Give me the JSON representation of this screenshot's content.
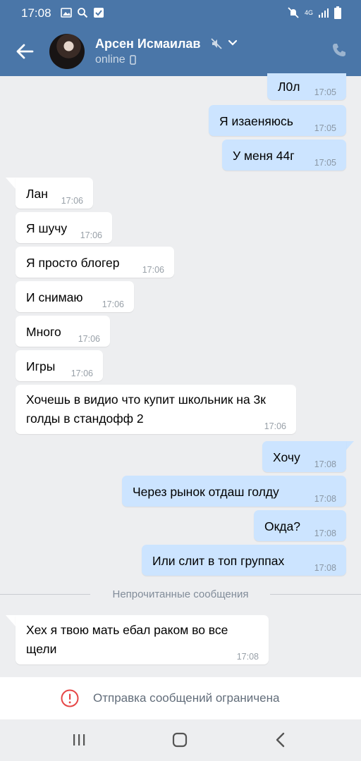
{
  "status_bar": {
    "time": "17:08",
    "network": "4G"
  },
  "header": {
    "contact_name": "Арсен Исмаилав",
    "status": "online"
  },
  "messages": [
    {
      "dir": "out",
      "text": "Л0л",
      "time": "17:05"
    },
    {
      "dir": "out",
      "text": "Я изаеняюсь",
      "time": "17:05"
    },
    {
      "dir": "out",
      "text": "У меня 44г",
      "time": "17:05"
    },
    {
      "dir": "in",
      "text": "Лан",
      "time": "17:06"
    },
    {
      "dir": "in",
      "text": "Я шучу",
      "time": "17:06"
    },
    {
      "dir": "in",
      "text": "Я просто блогер",
      "time": "17:06"
    },
    {
      "dir": "in",
      "text": "И снимаю",
      "time": "17:06"
    },
    {
      "dir": "in",
      "text": "Много",
      "time": "17:06"
    },
    {
      "dir": "in",
      "text": "Игры",
      "time": "17:06"
    },
    {
      "dir": "in",
      "text": "Хочешь в видио что купит школьник на 3к голды в стандофф 2",
      "time": "17:06"
    },
    {
      "dir": "out",
      "text": "Хочу",
      "time": "17:08"
    },
    {
      "dir": "out",
      "text": "Через рынок отдаш голду",
      "time": "17:08"
    },
    {
      "dir": "out",
      "text": "Окда?",
      "time": "17:08"
    },
    {
      "dir": "out",
      "text": "Или слит в топ группах",
      "time": "17:08"
    },
    {
      "dir": "in",
      "text": "Хех я твою мать ебал раком во все щели",
      "time": "17:08"
    }
  ],
  "unread_divider": "Непрочитанные сообщения",
  "restricted_notice": "Отправка сообщений ограничена",
  "colors": {
    "header": "#4a76a8",
    "outgoing_bubble": "#cce4ff",
    "incoming_bubble": "#ffffff",
    "background": "#edeef0",
    "alert": "#e64646"
  }
}
